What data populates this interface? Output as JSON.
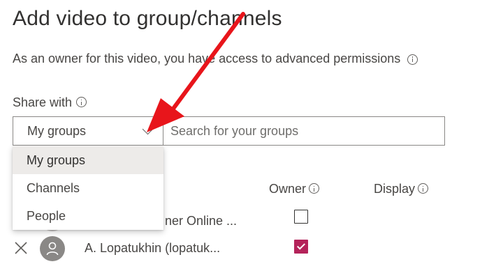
{
  "dialog": {
    "title": "Add video to group/channels",
    "description": "As an owner for this video, you have access to advanced permissions"
  },
  "share": {
    "label": "Share with",
    "selected": "My groups",
    "search_placeholder": "Search for your groups",
    "options": [
      "My groups",
      "Channels",
      "People"
    ]
  },
  "table": {
    "headers": {
      "owner": "Owner",
      "display": "Display"
    },
    "rows": [
      {
        "name": "ner Online ...",
        "owner_checked": false
      },
      {
        "name": "A. Lopatukhin (lopatuk...",
        "owner_checked": true
      }
    ]
  },
  "icons": {
    "info": "info-icon",
    "chevron": "chevron-down-icon",
    "remove": "close-icon",
    "avatar": "person-icon",
    "annotation": "red-arrow"
  },
  "colors": {
    "checkbox_checked": "#b4235a",
    "annotation_arrow": "#e8151b",
    "selected_option_bg": "#edebe9"
  }
}
